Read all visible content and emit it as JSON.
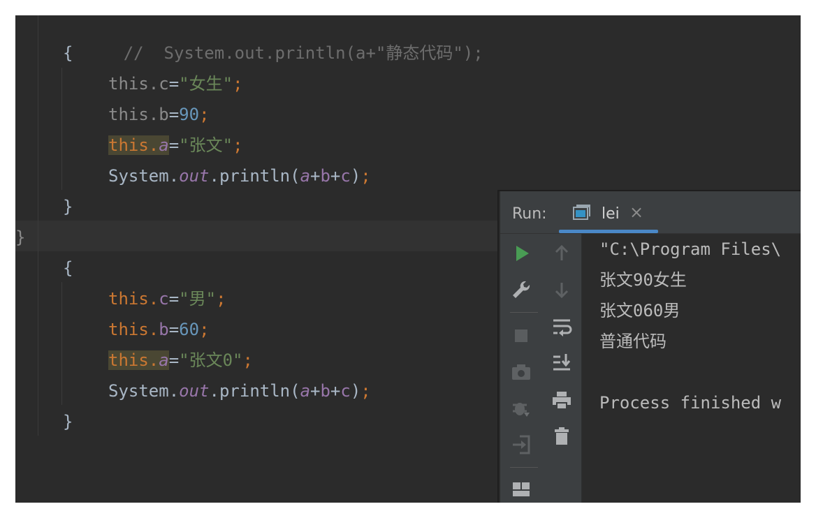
{
  "editor": {
    "lines": [
      {
        "prefix": "//  ",
        "text": "System.out.println(a+\"静态代码\");"
      },
      {
        "text": "{"
      },
      {
        "obj": "this.",
        "field": "c",
        "op": "=",
        "value": "\"女生\"",
        "end": ";"
      },
      {
        "obj": "this.",
        "field": "b",
        "op": "=",
        "value": "90",
        "end": ";"
      },
      {
        "obj": "this.",
        "field": "a",
        "op": "=",
        "value": "\"张文\"",
        "end": ";"
      },
      {
        "sys": "System.",
        "out": "out",
        "call": ".println(",
        "a": "a",
        "p1": "+",
        "b": "b",
        "p2": "+",
        "c": "c",
        "close": ")",
        "end": ";"
      },
      {
        "text": "}"
      },
      {
        "text": "}"
      },
      {
        "text": "{"
      },
      {
        "obj": "this.",
        "field": "c",
        "op": "=",
        "value": "\"男\"",
        "end": ";"
      },
      {
        "obj": "this.",
        "field": "b",
        "op": "=",
        "value": "60",
        "end": ";"
      },
      {
        "obj": "this.",
        "field": "a",
        "op": "=",
        "value": "\"张文0\"",
        "end": ";"
      },
      {
        "sys": "System.",
        "out": "out",
        "call": ".println(",
        "a": "a",
        "p1": "+",
        "b": "b",
        "p2": "+",
        "c": "c",
        "close": ")",
        "end": ";"
      },
      {
        "text": "}"
      }
    ]
  },
  "run_panel": {
    "title": "Run:",
    "tab_label": "lei",
    "tab_close": "×",
    "toolbar_left": [
      "run-icon",
      "wrench-icon",
      "stop-icon",
      "camera-icon",
      "debug-icon",
      "login-icon",
      "layout-icon"
    ],
    "toolbar_right": [
      "arrow-up-icon",
      "arrow-down-icon",
      "soft-wrap-icon",
      "scroll-to-end-icon",
      "print-icon",
      "trash-icon"
    ],
    "console_lines": [
      "\"C:\\Program Files\\",
      "张文90女生",
      "张文060男",
      "普通代码",
      "",
      "Process finished w"
    ]
  },
  "colors": {
    "editor_bg": "#2b2b2b",
    "keyword": "#cc7832",
    "string": "#6a8759",
    "number": "#6897bb",
    "field": "#9876aa",
    "run_green": "#499c54",
    "tab_underline": "#4a88c7"
  }
}
